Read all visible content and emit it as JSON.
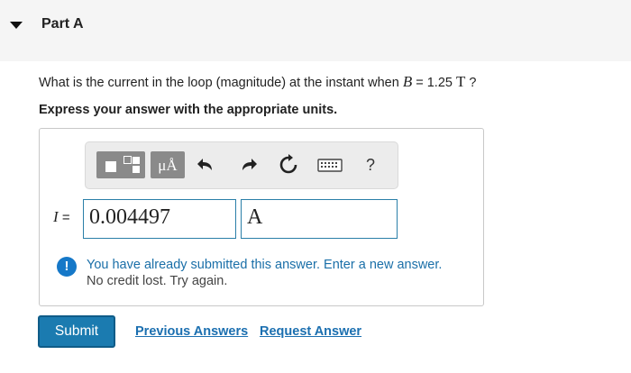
{
  "part": {
    "title": "Part A"
  },
  "question": {
    "prefix": "What is the current in the loop (magnitude) at the instant when ",
    "variable": "B",
    "equals_value": " = 1.25 ",
    "unit": "T",
    "suffix": " ?"
  },
  "instruction": "Express your answer with the appropriate units.",
  "toolbar": {
    "units_button_label": "μÅ",
    "help_label": "?"
  },
  "answer": {
    "variable": "I",
    "equals": " =",
    "value": "0.004497",
    "unit": "A"
  },
  "feedback": {
    "icon_label": "!",
    "message": "You have already submitted this answer. Enter a new answer.",
    "submessage": "No credit lost. Try again."
  },
  "actions": {
    "submit_label": "Submit",
    "previous_answers_label": "Previous Answers",
    "request_answer_label": "Request Answer"
  }
}
